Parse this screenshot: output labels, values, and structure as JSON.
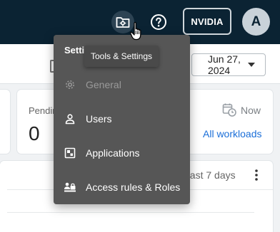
{
  "topbar": {
    "tools_icon": "folder-gear-icon",
    "help_icon": "help-circle-icon",
    "org_button_label": "NVIDIA",
    "avatar_initial": "A"
  },
  "filters": {
    "date_value": "Jun 27, 2024"
  },
  "summary": {
    "pending_label": "Pending",
    "pending_value": "0",
    "now_label": "Now",
    "all_workloads_link": "All workloads"
  },
  "panel": {
    "range_label": "Last 7 days"
  },
  "menu": {
    "header": "Settings",
    "items": [
      {
        "label": "General",
        "icon": "gear-icon",
        "disabled": true
      },
      {
        "label": "Users",
        "icon": "person-icon",
        "disabled": false
      },
      {
        "label": "Applications",
        "icon": "application-icon",
        "disabled": false
      },
      {
        "label": "Access rules & Roles",
        "icon": "access-rules-icon",
        "disabled": false
      }
    ]
  },
  "tooltip": {
    "text": "Tools & Settings"
  },
  "colors": {
    "topbar_bg": "#0b2333",
    "menu_bg": "#565656",
    "tooltip_bg": "#4a4a4a",
    "link": "#1a6ed8",
    "page_bg": "#f0f2f4"
  }
}
